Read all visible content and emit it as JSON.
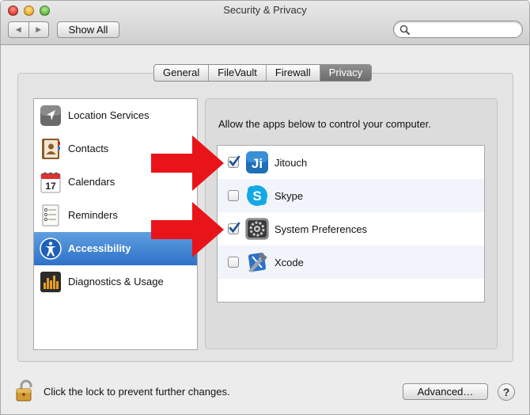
{
  "window": {
    "title": "Security & Privacy",
    "show_all_label": "Show All",
    "search": {
      "placeholder": "",
      "value": ""
    }
  },
  "tabs": [
    {
      "label": "General",
      "selected": false
    },
    {
      "label": "FileVault",
      "selected": false
    },
    {
      "label": "Firewall",
      "selected": false
    },
    {
      "label": "Privacy",
      "selected": true
    }
  ],
  "sidebar": {
    "items": [
      {
        "label": "Location Services",
        "icon": "location-arrow-icon",
        "selected": false
      },
      {
        "label": "Contacts",
        "icon": "contacts-book-icon",
        "selected": false
      },
      {
        "label": "Calendars",
        "icon": "calendar-icon",
        "selected": false
      },
      {
        "label": "Reminders",
        "icon": "reminders-list-icon",
        "selected": false
      },
      {
        "label": "Accessibility",
        "icon": "accessibility-icon",
        "selected": true
      },
      {
        "label": "Diagnostics & Usage",
        "icon": "diagnostics-icon",
        "selected": false
      }
    ],
    "calendar_day": "17"
  },
  "panel": {
    "prompt": "Allow the apps below to control your computer.",
    "apps": [
      {
        "label": "Jitouch",
        "checked": true,
        "icon": "jitouch-icon",
        "icon_text": "Ji"
      },
      {
        "label": "Skype",
        "checked": false,
        "icon": "skype-icon",
        "icon_text": "S"
      },
      {
        "label": "System Preferences",
        "checked": true,
        "icon": "system-preferences-icon"
      },
      {
        "label": "Xcode",
        "checked": false,
        "icon": "xcode-icon"
      }
    ]
  },
  "footer": {
    "lock_text": "Click the lock to prevent further changes.",
    "advanced_label": "Advanced…",
    "help_label": "?"
  },
  "colors": {
    "selection": "#2f71c7",
    "arrow": "#e8141a",
    "checkmark": "#1c4f9c"
  }
}
